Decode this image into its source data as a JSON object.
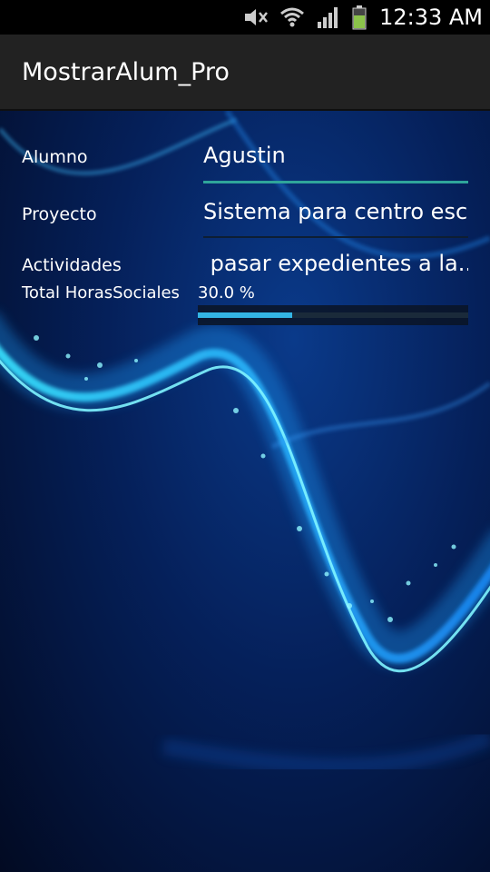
{
  "status_bar": {
    "time": "12:33 AM",
    "icons": [
      "mute-icon",
      "wifi-icon",
      "signal-icon",
      "battery-icon"
    ]
  },
  "app": {
    "title": "MostrarAlum_Pro"
  },
  "form": {
    "alumno_label": "Alumno",
    "alumno_value": "Agustin",
    "proyecto_label": "Proyecto",
    "proyecto_value": "Sistema para centro esc",
    "actividades_label": "Actividades",
    "actividades_value": " pasar expedientes a la..",
    "horas_label": "Total HorasSociales",
    "horas_value": "30.0 %",
    "progress_fraction": 0.35
  },
  "colors": {
    "accent": "#33b5e5",
    "focus_underline": "#2fa59a",
    "action_bar": "#222222"
  }
}
